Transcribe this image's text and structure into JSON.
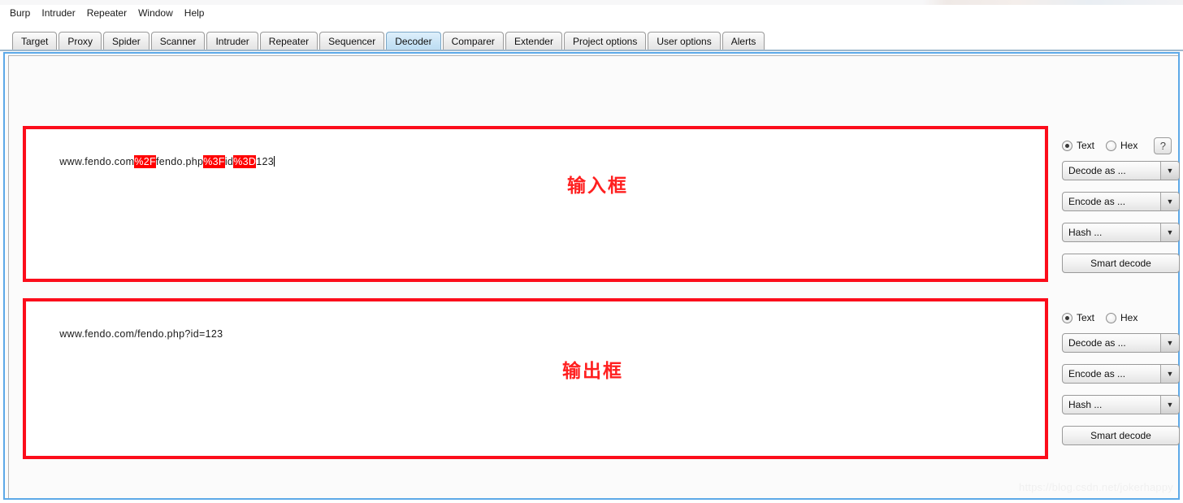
{
  "app": {
    "name": "Burp Suite",
    "watermark": "https://blog.csdn.net/jokerhappy"
  },
  "menubar": {
    "items": [
      {
        "label": "Burp"
      },
      {
        "label": "Intruder"
      },
      {
        "label": "Repeater"
      },
      {
        "label": "Window"
      },
      {
        "label": "Help"
      }
    ]
  },
  "tabs": {
    "selected": "Decoder",
    "items": [
      {
        "label": "Target",
        "selected": false
      },
      {
        "label": "Proxy",
        "selected": false
      },
      {
        "label": "Spider",
        "selected": false
      },
      {
        "label": "Scanner",
        "selected": false
      },
      {
        "label": "Intruder",
        "selected": false
      },
      {
        "label": "Repeater",
        "selected": false
      },
      {
        "label": "Sequencer",
        "selected": false
      },
      {
        "label": "Decoder",
        "selected": true
      },
      {
        "label": "Comparer",
        "selected": false
      },
      {
        "label": "Extender",
        "selected": false
      },
      {
        "label": "Project options",
        "selected": false
      },
      {
        "label": "User options",
        "selected": false
      },
      {
        "label": "Alerts",
        "selected": false
      }
    ]
  },
  "decoder": {
    "input_panel": {
      "annotation": "输入框",
      "annotation_color": "#ff2020",
      "text_segments": [
        {
          "text": "www.fendo.com",
          "highlight": false
        },
        {
          "text": "%2F",
          "highlight": true
        },
        {
          "text": "fendo.php",
          "highlight": false
        },
        {
          "text": "%3F",
          "highlight": true
        },
        {
          "text": "id",
          "highlight": false
        },
        {
          "text": "%3D",
          "highlight": true
        },
        {
          "text": "123",
          "highlight": false
        }
      ],
      "plain_value": "www.fendo.com%2Ffendo.php%3Fid%3D123",
      "caret_visible": true,
      "controls": {
        "format_text_label": "Text",
        "format_hex_label": "Hex",
        "format_selected": "Text",
        "help_label": "?",
        "decode_as_label": "Decode as ...",
        "encode_as_label": "Encode as ...",
        "hash_label": "Hash ...",
        "smart_decode_label": "Smart decode",
        "dropdown_arrow": "▼"
      }
    },
    "output_panel": {
      "annotation": "输出框",
      "annotation_color": "#ff2020",
      "text_segments": [
        {
          "text": "www.fendo.com/fendo.php?id=123",
          "highlight": false
        }
      ],
      "plain_value": "www.fendo.com/fendo.php?id=123",
      "caret_visible": false,
      "controls": {
        "format_text_label": "Text",
        "format_hex_label": "Hex",
        "format_selected": "Text",
        "decode_as_label": "Decode as ...",
        "encode_as_label": "Encode as ...",
        "hash_label": "Hash ...",
        "smart_decode_label": "Smart decode",
        "dropdown_arrow": "▼"
      }
    }
  },
  "annotations": {
    "box_color": "#fc0d1b"
  }
}
